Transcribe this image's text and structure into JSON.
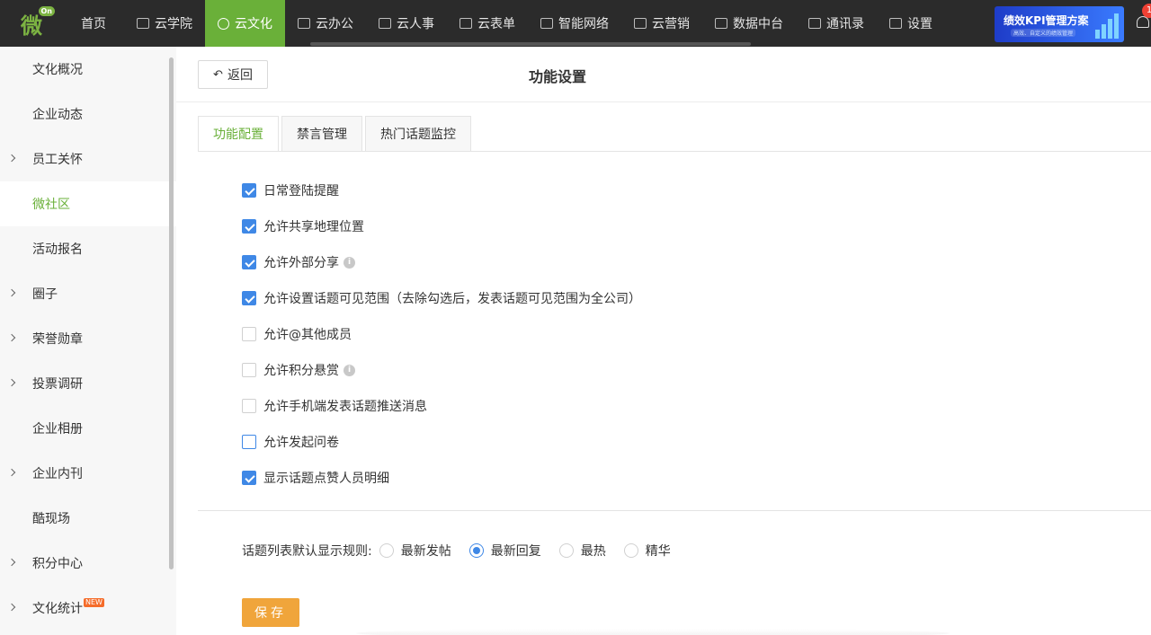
{
  "topbar": {
    "logo_char": "微",
    "logo_badge": "On",
    "nav": [
      {
        "label": "首页",
        "icon": "none",
        "active": false
      },
      {
        "label": "云学院",
        "icon": "video-icon",
        "active": false
      },
      {
        "label": "云文化",
        "icon": "gear-icon",
        "active": true
      },
      {
        "label": "云办公",
        "icon": "briefcase-icon",
        "active": false
      },
      {
        "label": "云人事",
        "icon": "person-icon",
        "active": false
      },
      {
        "label": "云表单",
        "icon": "form-icon",
        "active": false
      },
      {
        "label": "智能网络",
        "icon": "grid-icon",
        "active": false
      },
      {
        "label": "云营销",
        "icon": "chart-icon",
        "active": false
      },
      {
        "label": "数据中台",
        "icon": "cube-icon",
        "active": false
      },
      {
        "label": "通讯录",
        "icon": "contacts-icon",
        "active": false
      },
      {
        "label": "设置",
        "icon": "grid-icon",
        "active": false
      }
    ],
    "promo": {
      "title": "绩效KPI管理方案",
      "subtitle": "高效、自定义的绩效管理"
    },
    "notification_count": "1"
  },
  "sidebar": {
    "items": [
      {
        "label": "文化概况",
        "has_children": false,
        "active": false
      },
      {
        "label": "企业动态",
        "has_children": false,
        "active": false
      },
      {
        "label": "员工关怀",
        "has_children": true,
        "active": false
      },
      {
        "label": "微社区",
        "has_children": false,
        "active": true
      },
      {
        "label": "活动报名",
        "has_children": false,
        "active": false
      },
      {
        "label": "圈子",
        "has_children": true,
        "active": false
      },
      {
        "label": "荣誉勋章",
        "has_children": true,
        "active": false
      },
      {
        "label": "投票调研",
        "has_children": true,
        "active": false
      },
      {
        "label": "企业相册",
        "has_children": false,
        "active": false
      },
      {
        "label": "企业内刊",
        "has_children": true,
        "active": false
      },
      {
        "label": "酷现场",
        "has_children": false,
        "active": false
      },
      {
        "label": "积分中心",
        "has_children": true,
        "active": false
      },
      {
        "label": "文化统计",
        "has_children": true,
        "active": false,
        "badge": "NEW"
      }
    ]
  },
  "header": {
    "back_label": "返回",
    "title": "功能设置"
  },
  "tabs": [
    {
      "label": "功能配置",
      "active": true
    },
    {
      "label": "禁言管理",
      "active": false
    },
    {
      "label": "热门话题监控",
      "active": false
    }
  ],
  "options": [
    {
      "label": "日常登陆提醒",
      "checked": true,
      "info": false
    },
    {
      "label": "允许共享地理位置",
      "checked": true,
      "info": false
    },
    {
      "label": "允许外部分享",
      "checked": true,
      "info": true
    },
    {
      "label": "允许设置话题可见范围（去除勾选后，发表话题可见范围为全公司）",
      "checked": true,
      "info": false
    },
    {
      "label": "允许@其他成员",
      "checked": false,
      "info": false
    },
    {
      "label": "允许积分悬赏",
      "checked": false,
      "info": true
    },
    {
      "label": "允许手机端发表话题推送消息",
      "checked": false,
      "info": false
    },
    {
      "label": "允许发起问卷",
      "checked": false,
      "info": false,
      "focused": true
    },
    {
      "label": "显示话题点赞人员明细",
      "checked": true,
      "info": false
    }
  ],
  "sort_rule": {
    "label": "话题列表默认显示规则:",
    "choices": [
      {
        "label": "最新发帖",
        "selected": false
      },
      {
        "label": "最新回复",
        "selected": true
      },
      {
        "label": "最热",
        "selected": false
      },
      {
        "label": "精华",
        "selected": false
      }
    ]
  },
  "save_label": "保存",
  "colors": {
    "accent_green": "#6ab039",
    "checkbox_blue": "#3f88e6",
    "save_orange": "#f0a53b",
    "topbar": "#2b2b2b"
  }
}
